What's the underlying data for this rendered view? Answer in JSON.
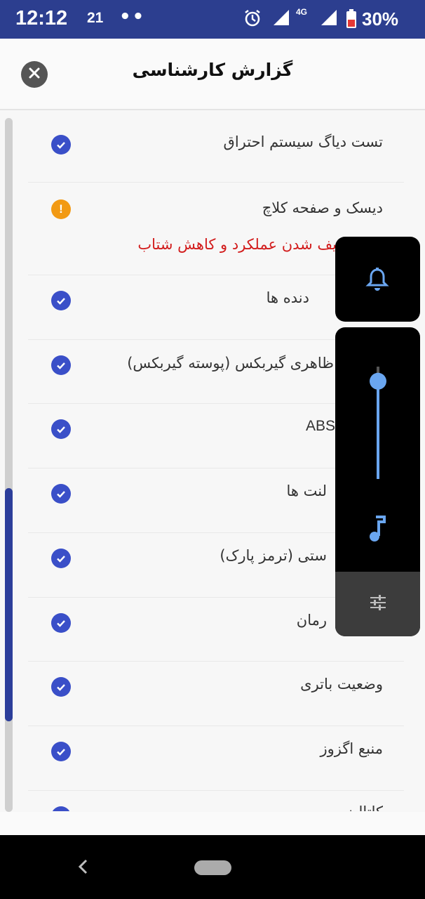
{
  "status_bar": {
    "time": "12:12",
    "notification_count": "21",
    "dots": "••",
    "network": "4G",
    "battery": "30%",
    "icons": [
      "alarm-icon",
      "signal-icon",
      "signal-icon",
      "battery-low-icon"
    ]
  },
  "header": {
    "title": "گزارش کارشناسی",
    "close_icon": "close-icon"
  },
  "items": [
    {
      "label": "تست دیاگ سیستم احتراق",
      "status": "ok"
    },
    {
      "label": "دیسک و صفحه کلاچ",
      "status": "warning",
      "note": "یف شدن عملکرد و کاهش شتاب"
    },
    {
      "label": "دنده ها",
      "status": "ok"
    },
    {
      "label": "ظاهری گیربکس (پوسته گیربکس)",
      "status": "ok"
    },
    {
      "label": "ABS",
      "status": "ok"
    },
    {
      "label": "لنت ها",
      "status": "ok"
    },
    {
      "label": "ستی (ترمز پارک)",
      "status": "ok"
    },
    {
      "label": "رمان",
      "status": "ok"
    },
    {
      "label": "وضعیت باتری",
      "status": "ok"
    },
    {
      "label": "منبع اگزوز",
      "status": "ok"
    },
    {
      "label": "کاتالیزور",
      "status": "ok"
    }
  ],
  "colors": {
    "status_bar": "#2c3e8f",
    "check": "#3a4fc8",
    "warning": "#f29a14",
    "note_text": "#d21c1c",
    "volume_accent": "#6aa6f0"
  },
  "volume_overlay": {
    "ringer_icon": "bell-icon",
    "media_icon": "music-note-icon",
    "settings_icon": "sliders-icon",
    "level": 0.87
  },
  "nav": {
    "back_icon": "back-chevron-icon",
    "home_icon": "home-pill-icon"
  }
}
